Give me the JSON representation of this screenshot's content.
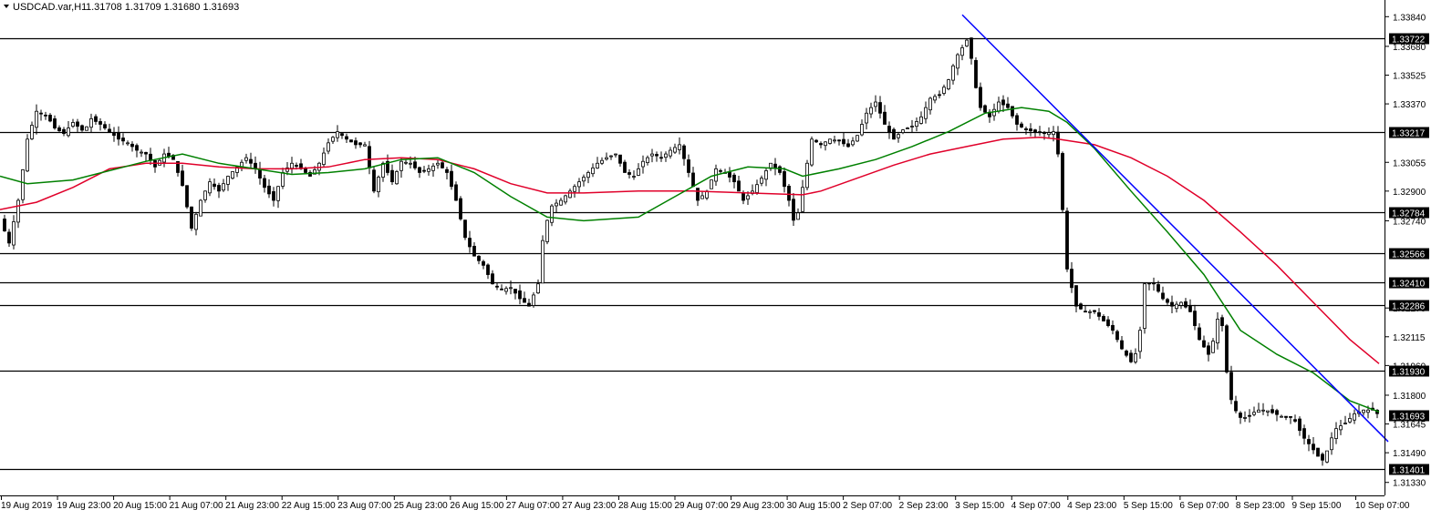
{
  "header": {
    "symbol": "USDCAD.var,H1",
    "ohlc": "1.31708 1.31709 1.31680 1.31693"
  },
  "colors": {
    "background": "#ffffff",
    "candle": "#000000",
    "bull_wick_highlight": "#00c000",
    "ma_fast": "#008000",
    "ma_slow": "#e0002a",
    "trendline": "#0000ff",
    "level_line": "#000000",
    "level_label_bg": "#000000"
  },
  "chart_data": {
    "type": "candlestick",
    "symbol": "USDCAD",
    "timeframe": "H1",
    "ylim": [
      1.3126,
      1.3392
    ],
    "y_ticks": [
      "1.33840",
      "1.33680",
      "1.33525",
      "1.33370",
      "1.33055",
      "1.32900",
      "1.32740",
      "1.32270",
      "1.32115",
      "1.31960",
      "1.31800",
      "1.31645",
      "1.31490",
      "1.31330"
    ],
    "x_ticks": [
      "19 Aug 2019",
      "19 Aug 23:00",
      "20 Aug 15:00",
      "21 Aug 07:00",
      "21 Aug 23:00",
      "22 Aug 15:00",
      "23 Aug 07:00",
      "25 Aug 23:00",
      "26 Aug 15:00",
      "27 Aug 07:00",
      "27 Aug 23:00",
      "28 Aug 15:00",
      "29 Aug 07:00",
      "29 Aug 23:00",
      "30 Aug 15:00",
      "2 Sep 07:00",
      "2 Sep 23:00",
      "3 Sep 15:00",
      "4 Sep 07:00",
      "4 Sep 23:00",
      "5 Sep 15:00",
      "6 Sep 07:00",
      "8 Sep 23:00",
      "9 Sep 15:00",
      "10 Sep 07:00"
    ],
    "horizontal_levels": [
      "1.33722",
      "1.33217",
      "1.32784",
      "1.32566",
      "1.32410",
      "1.32286",
      "1.31930",
      "1.31401"
    ],
    "current_price": "1.31693",
    "close_path": [
      [
        0,
        1.3275
      ],
      [
        10,
        1.3262
      ],
      [
        20,
        1.3285
      ],
      [
        30,
        1.3318
      ],
      [
        40,
        1.3333
      ],
      [
        52,
        1.333
      ],
      [
        60,
        1.3324
      ],
      [
        70,
        1.3321
      ],
      [
        80,
        1.3327
      ],
      [
        92,
        1.3322
      ],
      [
        100,
        1.3329
      ],
      [
        110,
        1.3326
      ],
      [
        120,
        1.3322
      ],
      [
        130,
        1.3318
      ],
      [
        140,
        1.3316
      ],
      [
        150,
        1.3312
      ],
      [
        160,
        1.331
      ],
      [
        170,
        1.3303
      ],
      [
        180,
        1.331
      ],
      [
        190,
        1.3307
      ],
      [
        200,
        1.3293
      ],
      [
        210,
        1.327
      ],
      [
        220,
        1.3285
      ],
      [
        230,
        1.3295
      ],
      [
        240,
        1.329
      ],
      [
        250,
        1.3298
      ],
      [
        260,
        1.3303
      ],
      [
        270,
        1.3308
      ],
      [
        280,
        1.3302
      ],
      [
        290,
        1.3292
      ],
      [
        300,
        1.3285
      ],
      [
        310,
        1.33
      ],
      [
        320,
        1.3305
      ],
      [
        330,
        1.3302
      ],
      [
        340,
        1.3298
      ],
      [
        350,
        1.3305
      ],
      [
        360,
        1.3316
      ],
      [
        370,
        1.3322
      ],
      [
        380,
        1.3318
      ],
      [
        390,
        1.3315
      ],
      [
        400,
        1.3315
      ],
      [
        410,
        1.329
      ],
      [
        420,
        1.3305
      ],
      [
        430,
        1.3295
      ],
      [
        440,
        1.3306
      ],
      [
        450,
        1.3305
      ],
      [
        460,
        1.33
      ],
      [
        470,
        1.3302
      ],
      [
        480,
        1.3305
      ],
      [
        490,
        1.33
      ],
      [
        500,
        1.3285
      ],
      [
        510,
        1.3265
      ],
      [
        520,
        1.3255
      ],
      [
        530,
        1.325
      ],
      [
        540,
        1.324
      ],
      [
        550,
        1.3237
      ],
      [
        560,
        1.3238
      ],
      [
        570,
        1.3232
      ],
      [
        580,
        1.3228
      ],
      [
        590,
        1.324
      ],
      [
        596,
        1.3268
      ],
      [
        605,
        1.3282
      ],
      [
        615,
        1.3285
      ],
      [
        625,
        1.329
      ],
      [
        635,
        1.3295
      ],
      [
        645,
        1.33
      ],
      [
        655,
        1.3305
      ],
      [
        665,
        1.3308
      ],
      [
        675,
        1.331
      ],
      [
        685,
        1.33
      ],
      [
        695,
        1.3298
      ],
      [
        705,
        1.3306
      ],
      [
        715,
        1.331
      ],
      [
        725,
        1.3308
      ],
      [
        735,
        1.3312
      ],
      [
        745,
        1.3315
      ],
      [
        755,
        1.33
      ],
      [
        765,
        1.3285
      ],
      [
        775,
        1.329
      ],
      [
        785,
        1.3302
      ],
      [
        795,
        1.33
      ],
      [
        805,
        1.3295
      ],
      [
        815,
        1.3285
      ],
      [
        825,
        1.329
      ],
      [
        835,
        1.3297
      ],
      [
        845,
        1.3305
      ],
      [
        855,
        1.33
      ],
      [
        865,
        1.3285
      ],
      [
        872,
        1.327
      ],
      [
        880,
        1.3292
      ],
      [
        890,
        1.3318
      ],
      [
        900,
        1.3315
      ],
      [
        910,
        1.3318
      ],
      [
        920,
        1.3317
      ],
      [
        930,
        1.3314
      ],
      [
        940,
        1.332
      ],
      [
        950,
        1.3332
      ],
      [
        960,
        1.3338
      ],
      [
        970,
        1.3326
      ],
      [
        980,
        1.3318
      ],
      [
        990,
        1.3323
      ],
      [
        1000,
        1.3325
      ],
      [
        1010,
        1.333
      ],
      [
        1020,
        1.334
      ],
      [
        1030,
        1.3342
      ],
      [
        1040,
        1.335
      ],
      [
        1048,
        1.3362
      ],
      [
        1056,
        1.3368
      ],
      [
        1062,
        1.3373
      ],
      [
        1068,
        1.335
      ],
      [
        1075,
        1.3335
      ],
      [
        1085,
        1.333
      ],
      [
        1095,
        1.3338
      ],
      [
        1105,
        1.3335
      ],
      [
        1115,
        1.3326
      ],
      [
        1125,
        1.3323
      ],
      [
        1135,
        1.3322
      ],
      [
        1145,
        1.3321
      ],
      [
        1155,
        1.3322
      ],
      [
        1160,
        1.331
      ],
      [
        1165,
        1.328
      ],
      [
        1170,
        1.3248
      ],
      [
        1180,
        1.3228
      ],
      [
        1190,
        1.3225
      ],
      [
        1200,
        1.3225
      ],
      [
        1210,
        1.322
      ],
      [
        1220,
        1.3215
      ],
      [
        1230,
        1.3205
      ],
      [
        1240,
        1.3198
      ],
      [
        1248,
        1.3205
      ],
      [
        1255,
        1.324
      ],
      [
        1265,
        1.324
      ],
      [
        1275,
        1.3232
      ],
      [
        1285,
        1.3228
      ],
      [
        1295,
        1.323
      ],
      [
        1305,
        1.3225
      ],
      [
        1315,
        1.321
      ],
      [
        1325,
        1.3202
      ],
      [
        1332,
        1.3212
      ],
      [
        1338,
        1.323
      ],
      [
        1342,
        1.3205
      ],
      [
        1348,
        1.318
      ],
      [
        1358,
        1.3168
      ],
      [
        1368,
        1.3168
      ],
      [
        1378,
        1.3172
      ],
      [
        1388,
        1.3172
      ],
      [
        1398,
        1.317
      ],
      [
        1408,
        1.3168
      ],
      [
        1418,
        1.3168
      ],
      [
        1428,
        1.3158
      ],
      [
        1438,
        1.3152
      ],
      [
        1448,
        1.3145
      ],
      [
        1452,
        1.3145
      ],
      [
        1458,
        1.3155
      ],
      [
        1465,
        1.3162
      ],
      [
        1475,
        1.3165
      ],
      [
        1485,
        1.317
      ],
      [
        1495,
        1.3172
      ],
      [
        1505,
        1.3172
      ],
      [
        1512,
        1.31693
      ]
    ],
    "ma_fast_path": [
      [
        0,
        1.3298
      ],
      [
        30,
        1.3294
      ],
      [
        80,
        1.3296
      ],
      [
        120,
        1.3301
      ],
      [
        160,
        1.3306
      ],
      [
        200,
        1.331
      ],
      [
        240,
        1.3305
      ],
      [
        280,
        1.3302
      ],
      [
        320,
        1.3299
      ],
      [
        360,
        1.33
      ],
      [
        400,
        1.3302
      ],
      [
        440,
        1.3307
      ],
      [
        480,
        1.3308
      ],
      [
        520,
        1.33
      ],
      [
        560,
        1.3287
      ],
      [
        600,
        1.3276
      ],
      [
        640,
        1.3274
      ],
      [
        700,
        1.3276
      ],
      [
        740,
        1.3287
      ],
      [
        780,
        1.3298
      ],
      [
        820,
        1.3303
      ],
      [
        860,
        1.3302
      ],
      [
        880,
        1.3298
      ],
      [
        920,
        1.3302
      ],
      [
        960,
        1.3307
      ],
      [
        1000,
        1.3314
      ],
      [
        1040,
        1.3322
      ],
      [
        1080,
        1.3332
      ],
      [
        1120,
        1.3335
      ],
      [
        1150,
        1.3333
      ],
      [
        1170,
        1.3327
      ],
      [
        1200,
        1.3313
      ],
      [
        1240,
        1.329
      ],
      [
        1280,
        1.3268
      ],
      [
        1320,
        1.3245
      ],
      [
        1360,
        1.3215
      ],
      [
        1400,
        1.3202
      ],
      [
        1440,
        1.3192
      ],
      [
        1480,
        1.3177
      ],
      [
        1512,
        1.3171
      ]
    ],
    "ma_slow_path": [
      [
        0,
        1.328
      ],
      [
        40,
        1.3284
      ],
      [
        80,
        1.3292
      ],
      [
        120,
        1.3302
      ],
      [
        160,
        1.3305
      ],
      [
        200,
        1.3305
      ],
      [
        240,
        1.3303
      ],
      [
        280,
        1.3302
      ],
      [
        320,
        1.3302
      ],
      [
        360,
        1.3303
      ],
      [
        400,
        1.3307
      ],
      [
        440,
        1.3308
      ],
      [
        480,
        1.3307
      ],
      [
        520,
        1.3302
      ],
      [
        560,
        1.3294
      ],
      [
        600,
        1.3289
      ],
      [
        640,
        1.3289
      ],
      [
        700,
        1.329
      ],
      [
        760,
        1.329
      ],
      [
        820,
        1.3289
      ],
      [
        880,
        1.3288
      ],
      [
        900,
        1.329
      ],
      [
        940,
        1.3297
      ],
      [
        980,
        1.3304
      ],
      [
        1020,
        1.331
      ],
      [
        1060,
        1.3314
      ],
      [
        1100,
        1.3318
      ],
      [
        1140,
        1.3319
      ],
      [
        1160,
        1.3318
      ],
      [
        1200,
        1.3315
      ],
      [
        1240,
        1.3308
      ],
      [
        1280,
        1.3298
      ],
      [
        1320,
        1.3285
      ],
      [
        1360,
        1.3268
      ],
      [
        1400,
        1.325
      ],
      [
        1440,
        1.323
      ],
      [
        1480,
        1.321
      ],
      [
        1512,
        1.3197
      ]
    ],
    "trendline": [
      [
        1055,
        1.3385
      ],
      [
        1522,
        1.3155
      ]
    ]
  }
}
